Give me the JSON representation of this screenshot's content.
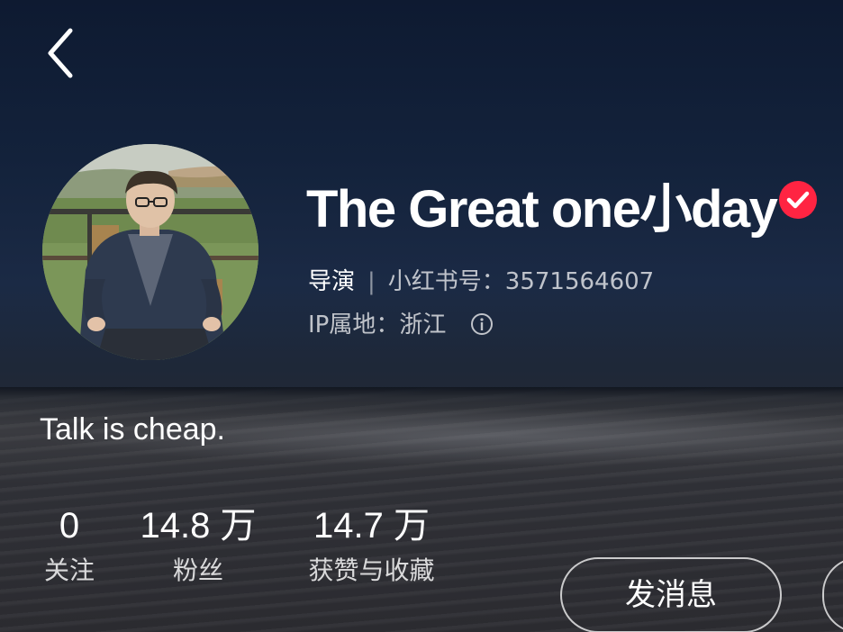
{
  "header": {
    "back_icon": "chevron-left-icon"
  },
  "profile": {
    "display_name": "The Great one小day",
    "verified_icon": "verified-check-icon",
    "role": "导演",
    "separator": "|",
    "account_id_label": "小红书号：",
    "account_id": "3571564607",
    "ip_label": "IP属地：",
    "ip_location": "浙江",
    "info_icon": "info-icon",
    "bio": "Talk is cheap."
  },
  "stats": [
    {
      "value": "0",
      "label": "关注"
    },
    {
      "value": "14.8 万",
      "label": "粉丝"
    },
    {
      "value": "14.7 万",
      "label": "获赞与收藏"
    }
  ],
  "actions": {
    "message_label": "发消息"
  },
  "colors": {
    "badge_red": "#ff2442",
    "background_top": "#0e1a31",
    "background_bottom": "#2a2a2e"
  }
}
